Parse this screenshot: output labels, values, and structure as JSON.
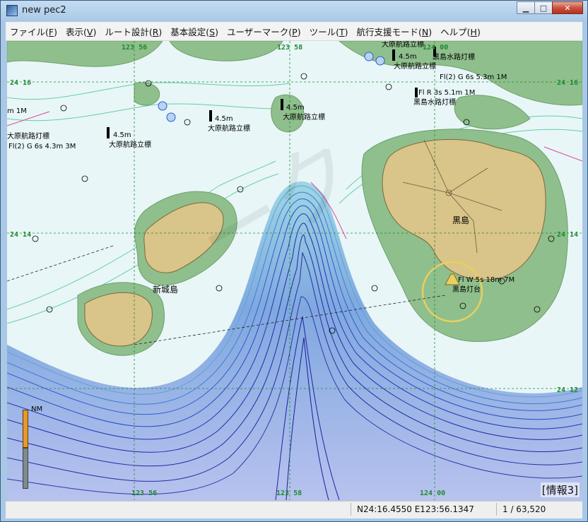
{
  "window": {
    "title": "new pec2",
    "minimize": "▁",
    "maximize": "□",
    "close": "✕"
  },
  "menu": [
    {
      "label": "ファイル(",
      "key": "F",
      "tail": ")"
    },
    {
      "label": "表示(",
      "key": "V",
      "tail": ")"
    },
    {
      "label": "ルート設計(",
      "key": "R",
      "tail": ")"
    },
    {
      "label": "基本設定(",
      "key": "S",
      "tail": ")"
    },
    {
      "label": "ユーザーマーク(",
      "key": "P",
      "tail": ")"
    },
    {
      "label": "ツール(",
      "key": "T",
      "tail": ")"
    },
    {
      "label": "航行支援モード(",
      "key": "N",
      "tail": ")"
    },
    {
      "label": "ヘルプ(",
      "key": "H",
      "tail": ")"
    }
  ],
  "map": {
    "grid_labels": {
      "lon_top": [
        "123 56",
        "123 58",
        "124 00"
      ],
      "lon_bottom": [
        "123 56",
        "123 58",
        "124 00"
      ],
      "lat_left": [
        "24 16",
        "24 14"
      ],
      "lat_right": [
        "24 16",
        "24 14",
        "24 12"
      ]
    },
    "islands": {
      "kuroshima": "黒島",
      "aragusuku": "新城島"
    },
    "beacons": [
      {
        "depth": "4.5m",
        "name": "大原航路立標"
      },
      {
        "depth": "4.5m",
        "name": "大原航路立標"
      },
      {
        "depth": "4.5m",
        "name": "大原航路立標"
      },
      {
        "depth": "4.5m",
        "name": "大原航路立標"
      }
    ],
    "lights": {
      "top_left_name": "大原航路灯標",
      "top_left_char": "Fl(2) G 6s 4.3m 3M",
      "top_right_name": "黒島水路灯標",
      "top_right_char": "Fl(2) G 6s 5.3m 1M",
      "mid_right_name": "黒島水路灯標",
      "mid_right_char": "Fl R 3s 5.1m 1M",
      "lighthouse_name": "黒島灯台",
      "lighthouse_char": "Fl W 5s 18m 7M",
      "left_edge_fragment": "m 1M"
    },
    "top_label": "大原航路立標"
  },
  "scale": {
    "unit": "NM"
  },
  "status": {
    "position": "N24:16.4550 E123:56.1347",
    "scale": "1 / 63,520"
  },
  "info_button": "[情報3]",
  "colors": {
    "land": "#d9c48a",
    "drying": "#8fbf8c",
    "shallow": "#e8f6f8",
    "deep": "#3a3fc8"
  }
}
